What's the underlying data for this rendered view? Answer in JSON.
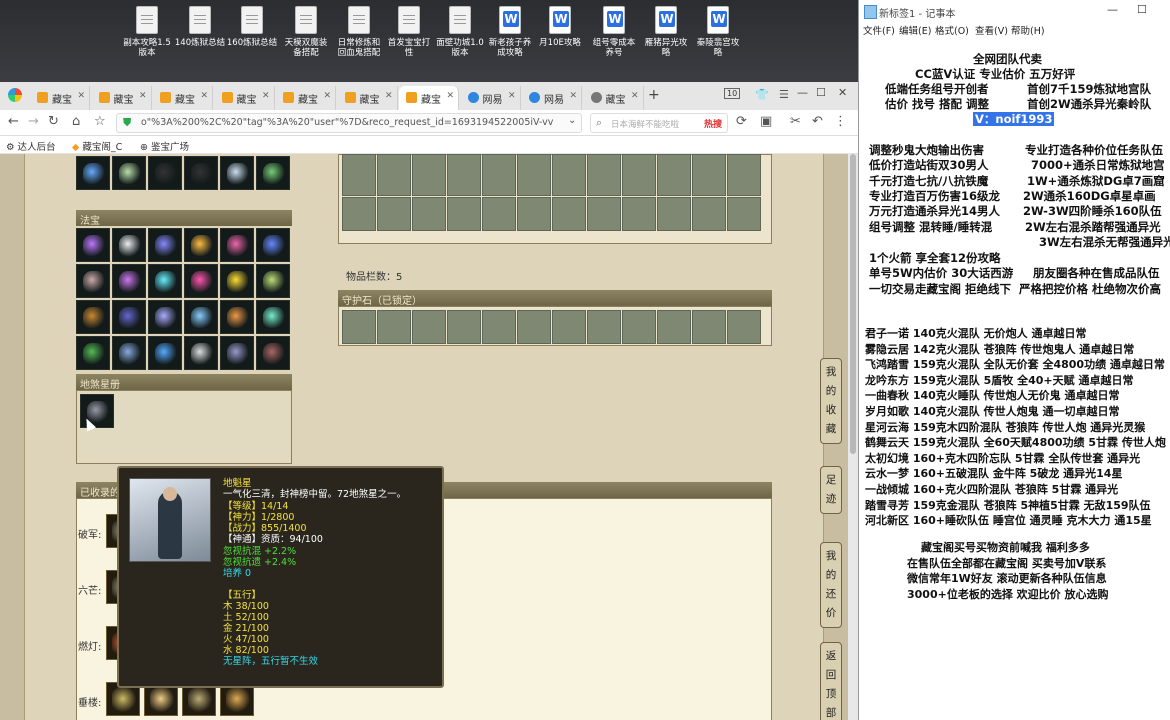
{
  "desktop": {
    "icons": [
      {
        "label": "副本攻略1.5\n版本",
        "kind": "doc"
      },
      {
        "label": "140炼狱总结",
        "kind": "doc"
      },
      {
        "label": "160炼狱总结",
        "kind": "doc"
      },
      {
        "label": "天模双魔装\n备搭配",
        "kind": "doc"
      },
      {
        "label": "日常修炼和\n回血鬼搭配",
        "kind": "doc"
      },
      {
        "label": "首发宝宝打\n性",
        "kind": "doc"
      },
      {
        "label": "面壁功城1.0\n版本",
        "kind": "doc"
      },
      {
        "label": "新老孩子养\n成攻略",
        "kind": "wps"
      },
      {
        "label": "月10E攻略",
        "kind": "wps"
      },
      {
        "label": "组号零成本\n养号",
        "kind": "wps"
      },
      {
        "label": "雁猪异光攻\n略",
        "kind": "wps"
      },
      {
        "label": "秦陵翡宫攻\n略",
        "kind": "wps"
      }
    ]
  },
  "browser": {
    "tabs": [
      {
        "label": "藏宝",
        "fav": "orange"
      },
      {
        "label": "藏宝",
        "fav": "orange"
      },
      {
        "label": "藏宝",
        "fav": "orange"
      },
      {
        "label": "藏宝",
        "fav": "orange"
      },
      {
        "label": "藏宝",
        "fav": "orange"
      },
      {
        "label": "藏宝",
        "fav": "orange"
      },
      {
        "label": "藏宝",
        "fav": "orange"
      },
      {
        "label": "网易",
        "fav": "blue"
      },
      {
        "label": "网易",
        "fav": "blue"
      },
      {
        "label": "藏宝",
        "fav": "globe"
      }
    ],
    "tab_count": "10",
    "new_tab": "+",
    "url": "o\"%3A%200%2C%20\"tag\"%3A%20\"user\"%7D&reco_request_id=1693194522005iV-vv",
    "search_placeholder": "日本海鲜不能吃啦",
    "hot_label": "热搜",
    "bookmarks": [
      "达人后台",
      "藏宝阁_C",
      "鉴宝广场"
    ]
  },
  "game": {
    "fabao_title": "法宝",
    "star_title": "地煞星册",
    "item_count_label": "物品栏数：5",
    "guard_title": "守护石（已锁定）",
    "collected_title": "已收录的",
    "rows": [
      {
        "label": "破军:"
      },
      {
        "label": "六芒:"
      },
      {
        "label": "燃灯:"
      },
      {
        "label": "垂楼:"
      }
    ],
    "side_buttons": [
      "我\n的\n收\n藏",
      "足\n迹",
      "我\n的\n还\n价",
      "返\n回\n顶\n部"
    ]
  },
  "tooltip": {
    "name": "地魁星",
    "desc": "一气化三清，封神榜中留。72地煞星之一。",
    "level": "【等级】14/14",
    "power": "【神力】1/2800",
    "combat": "【战力】855/1400",
    "shentong": "【神通】资质：94/100",
    "resist1": "忽视抗混 +2.2%",
    "resist2": "忽视抗遗 +2.4%",
    "cultivate": "培养 0",
    "wuxing_title": "【五行】",
    "wuxing": [
      "木 38/100",
      "土 52/100",
      "金 21/100",
      "火 47/100",
      "水 82/100"
    ],
    "note": "无星阵，五行暂不生效"
  },
  "notepad": {
    "title": "新标签1 - 记事本",
    "menu": [
      "文件(F)",
      "编辑(E)",
      "格式(O)",
      "查看(V)",
      "帮助(H)"
    ],
    "header_lines": [
      "全网团队代卖",
      "CC蓝V认证  专业估价 五万好评",
      "低端任务组号开创者",
      "首创7千159炼狱地宫队",
      "估价 找号 搭配 调整",
      "首创2W通杀异光秦岭队"
    ],
    "contact": "V：noif1993",
    "block1": [
      [
        "调整秒鬼大炮输出伤害",
        "专业打造各种价位任务队伍"
      ],
      [
        "低价打造站街双30男人",
        "7000+通杀日常炼狱地宫"
      ],
      [
        "千元打造七抗/八抗铁魔",
        "1W+通杀炼狱DG卓7画窟"
      ],
      [
        "专业打造百万伤害16级龙",
        "2W通杀160DG卓星卓画"
      ],
      [
        "万元打造通杀异光14男人",
        "2W-3W四阶睡杀160队伍"
      ],
      [
        "组号调整 混转睡/睡转混",
        "2W左右混杀踏帮强通异光"
      ],
      [
        "",
        "3W左右混杀无帮强通异光"
      ]
    ],
    "block2": [
      [
        "1个火箭 享全套12份攻略",
        ""
      ],
      [
        "单号5W内估价 30大话西游",
        "朋友圈各种在售成品队伍"
      ],
      [
        "一切交易走藏宝阁 拒绝线下",
        "严格把控价格 杜绝物次价高"
      ]
    ],
    "block3": [
      "君子一诺 140克火混队 无价炮人 通卓越日常",
      "雾隐云居 142克火混队 苍狼阵 传世炮鬼人 通卓越日常",
      "飞鸿踏雪 159克火混队 全队无价套 全4800功绩 通卓越日常",
      "龙吟东方 159克火混队 5盾牧 全40+天赋 通卓越日常",
      "一曲春秋 140克火睡队 传世炮人无价鬼 通卓越日常",
      "岁月如歌 140克火混队 传世人炮鬼 通一切卓越日常",
      "星河云海 159克木四阶混队 苍狼阵 传世人炮 通异光灵猴",
      "鹤舞云天 159克火混队 全60天赋4800功绩 5甘霖 传世人炮",
      "太初幻境 160+克木四阶忘队 5甘霖 全队传世套 通异光",
      "云水一梦 160+五破混队 金牛阵 5破龙 通异光14星",
      "一战倾城 160+克火四阶混队 苍狼阵 5甘霖 通异光",
      "踏雪寻芳 159克金混队 苍狼阵 5神植5甘霖 无敌159队伍",
      "河北新区 160+睡砍队伍 睡宫位 通灵睡 克木大力 通15星"
    ],
    "block4": [
      "藏宝阁买号买物资前喊我 福利多多",
      "在售队伍全部都在藏宝阁 买卖号加V联系",
      "微信常年1W好友 滚动更新各种队伍信息",
      "3000+位老板的选择 欢迎比价 放心选购"
    ]
  }
}
